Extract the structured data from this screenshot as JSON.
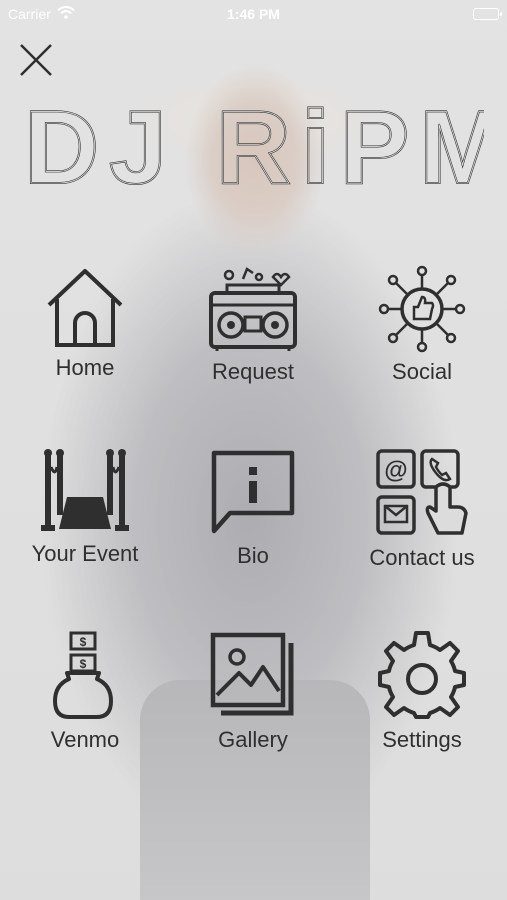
{
  "status_bar": {
    "carrier": "Carrier",
    "time": "1:46 PM",
    "battery_color": "#4cd964"
  },
  "header": {
    "close_icon": "close-icon",
    "logo_text": "DJ RiPM"
  },
  "menu": [
    {
      "label": "Home",
      "icon": "house-icon"
    },
    {
      "label": "Request",
      "icon": "boombox-icon"
    },
    {
      "label": "Social",
      "icon": "social-network-icon"
    },
    {
      "label": "Your Event",
      "icon": "red-carpet-icon"
    },
    {
      "label": "Bio",
      "icon": "info-bubble-icon"
    },
    {
      "label": "Contact us",
      "icon": "contact-icon"
    },
    {
      "label": "Venmo",
      "icon": "money-bag-icon"
    },
    {
      "label": "Gallery",
      "icon": "gallery-icon"
    },
    {
      "label": "Settings",
      "icon": "gear-icon"
    }
  ],
  "colors": {
    "icon_stroke": "#2f2f2f",
    "label_text": "#2f2f2f"
  }
}
